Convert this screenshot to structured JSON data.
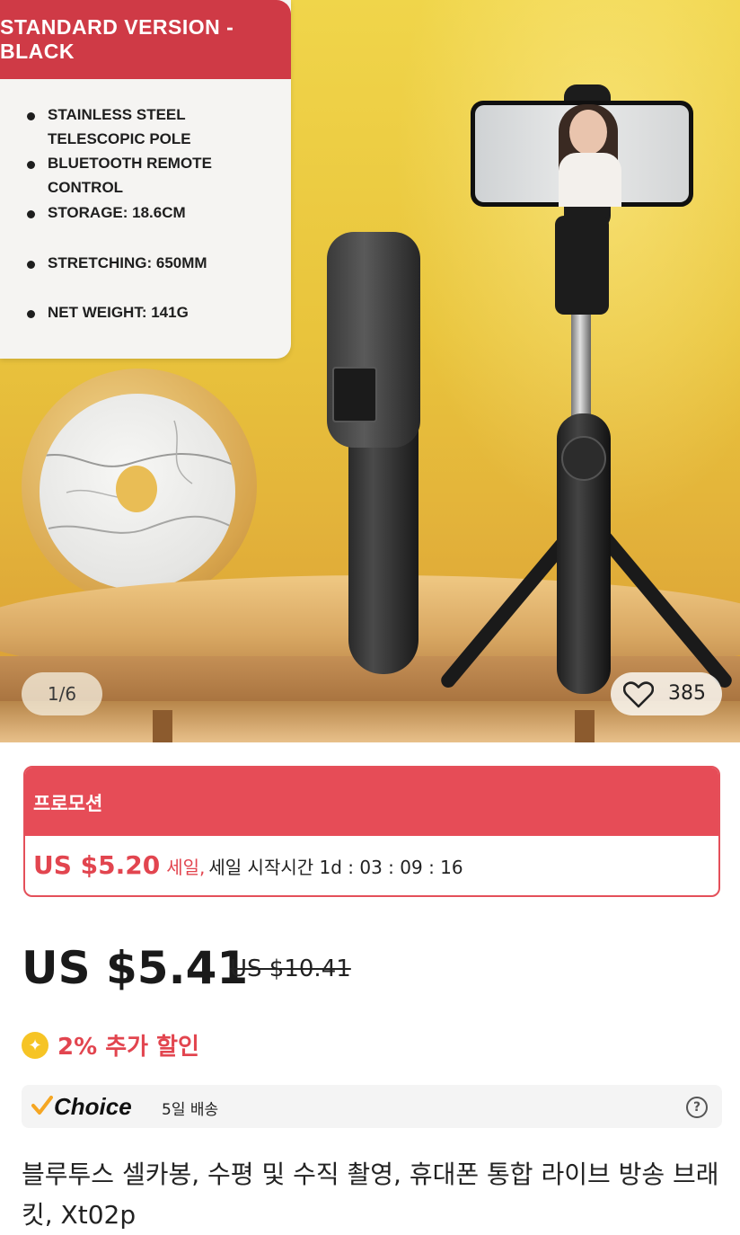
{
  "gallery": {
    "banner": "STANDARD VERSION - BLACK",
    "features": [
      "STAINLESS STEEL TELESCOPIC POLE",
      "BLUETOOTH REMOTE CONTROL",
      "STORAGE: 18.6CM",
      "STRETCHING: 650MM",
      "NET WEIGHT: 141G"
    ],
    "pager": "1/6",
    "favorites_count": "385",
    "favorite_icon": "heart-icon"
  },
  "promotion": {
    "header": "프로모션",
    "price": "US $5.20",
    "sale_label": "세일,",
    "countdown": "세일 시작시간 1d : 03 : 09 : 16"
  },
  "pricing": {
    "current": "US $5.41",
    "original": "US $10.41",
    "extra_discount": "2% 추가 할인",
    "coin_icon": "star-coin-icon"
  },
  "shipping": {
    "brand": "Choice",
    "days": "5일 배송",
    "help_icon": "question-icon"
  },
  "product": {
    "title": "블루투스 셀카봉, 수평 및 수직 촬영, 휴대폰 통합 라이브 방송 브래킷, Xt02p"
  },
  "colors": {
    "accent_red": "#e64c57",
    "banner_red": "#cf3a46",
    "coin_yellow": "#f6c425",
    "choice_check": "#f5a623"
  }
}
